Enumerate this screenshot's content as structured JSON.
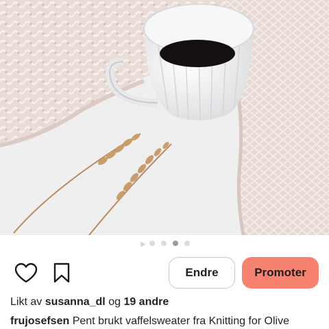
{
  "post": {
    "image_alt": "coffee-cup-on-knit-sweater-photo",
    "carousel": {
      "total_dots": 4,
      "active_index": 2
    },
    "actions": {
      "like_icon": "heart-icon",
      "bookmark_icon": "bookmark-icon",
      "edit_label": "Endre",
      "promote_label": "Promoter"
    },
    "likes": {
      "prefix": "Likt av",
      "user": "susanna_dl",
      "connector": "og",
      "others": "19 andre"
    },
    "caption": {
      "username": "frujosefsen",
      "text": "Pent brukt vaffelsweater fra Knitting for Olive"
    }
  },
  "colors": {
    "promote_bg": "#f7826f",
    "edit_border": "#c9c9c9",
    "dot_active": "#9a9a9a",
    "dot_inactive": "#dcdcdc"
  }
}
